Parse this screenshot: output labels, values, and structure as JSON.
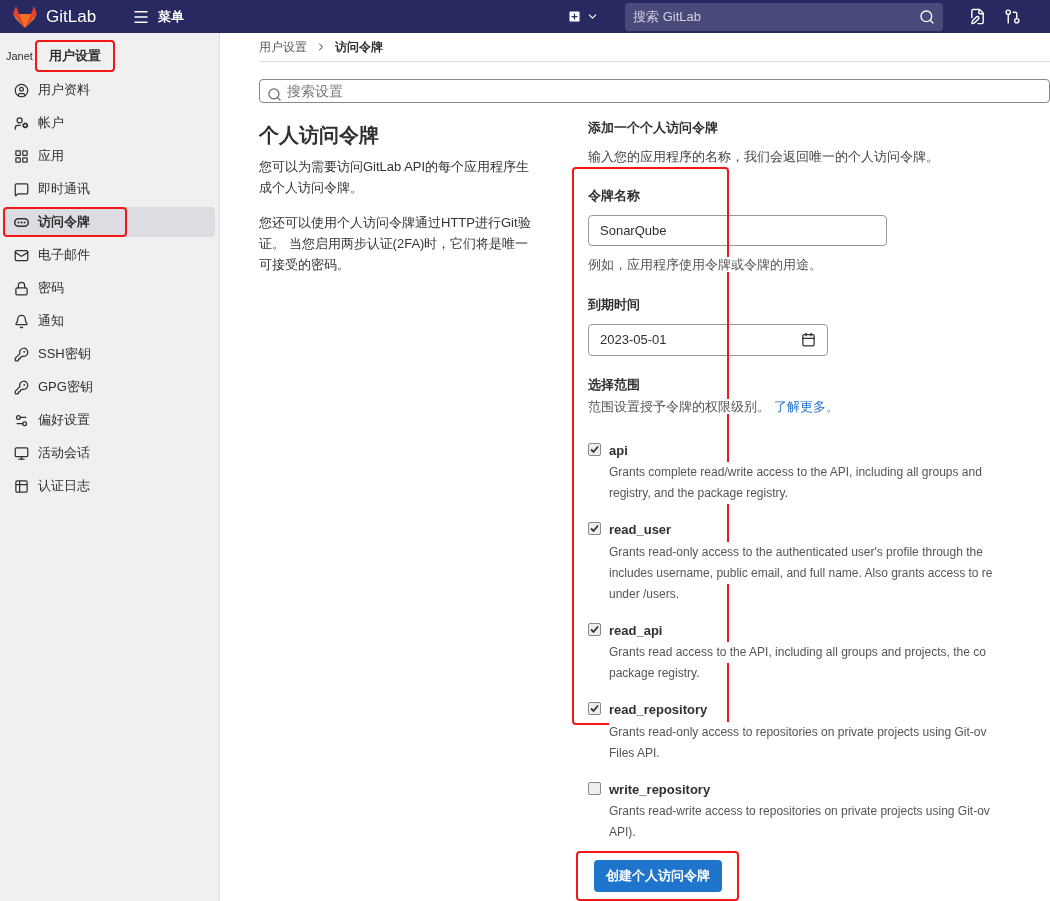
{
  "header": {
    "brand": "GitLab",
    "menu": "菜单",
    "search": {
      "placeholder": "搜索 GitLab"
    }
  },
  "sidebar": {
    "avatar_alt": "Janet",
    "title": "用户设置",
    "highlighted": true,
    "items": [
      {
        "label": "用户资料",
        "selected": false,
        "highlighted": false
      },
      {
        "label": "帐户",
        "selected": false,
        "highlighted": false
      },
      {
        "label": "应用",
        "selected": false,
        "highlighted": false
      },
      {
        "label": "即时通讯",
        "selected": false,
        "highlighted": false
      },
      {
        "label": "访问令牌",
        "selected": true,
        "highlighted": true
      },
      {
        "label": "电子邮件",
        "selected": false,
        "highlighted": false
      },
      {
        "label": "密码",
        "selected": false,
        "highlighted": false
      },
      {
        "label": "通知",
        "selected": false,
        "highlighted": false
      },
      {
        "label": "SSH密钥",
        "selected": false,
        "highlighted": false
      },
      {
        "label": "GPG密钥",
        "selected": false,
        "highlighted": false
      },
      {
        "label": "偏好设置",
        "selected": false,
        "highlighted": false
      },
      {
        "label": "活动会话",
        "selected": false,
        "highlighted": false
      },
      {
        "label": "认证日志",
        "selected": false,
        "highlighted": false
      }
    ]
  },
  "breadcrumb": [
    "用户设置",
    "访问令牌"
  ],
  "settings_search": {
    "placeholder": "搜索设置"
  },
  "intro": {
    "title": "个人访问令牌",
    "paragraphs": [
      "您可以为需要访问GitLab API的每个应用程序生成个人访问令牌。",
      "您还可以使用个人访问令牌通过HTTP进行Git验证。 当您启用两步认证(2FA)时，它们将是唯一可接受的密码。"
    ]
  },
  "form": {
    "heading": "添加一个个人访问令牌",
    "subheading": "输入您的应用程序的名称，我们会返回唯一的个人访问令牌。",
    "highlighted": true,
    "name_label": "令牌名称",
    "name_value": "SonarQube",
    "name_help": "例如，应用程序使用令牌或令牌的用途。",
    "expiry_label": "到期时间",
    "expiry_value": "2023-05-01",
    "scope_label": "选择范围",
    "scope_help": "范围设置授予令牌的权限级别。",
    "scope_link": "了解更多。",
    "scopes": [
      {
        "name": "api",
        "checked": true,
        "lines": [
          "Grants complete read/write access to the API, including all groups and",
          "registry, and the package registry."
        ]
      },
      {
        "name": "read_user",
        "checked": true,
        "lines": [
          "Grants read-only access to the authenticated user's profile through the",
          "includes username, public email, and full name. Also grants access to re",
          "under /users."
        ]
      },
      {
        "name": "read_api",
        "checked": true,
        "lines": [
          "Grants read access to the API, including all groups and projects, the co",
          "package registry."
        ]
      },
      {
        "name": "read_repository",
        "checked": true,
        "lines": [
          "Grants read-only access to repositories on private projects using Git-ov",
          "Files API."
        ]
      },
      {
        "name": "write_repository",
        "checked": false,
        "lines": [
          "Grants read-write access to repositories on private projects using Git-ov",
          "API)."
        ]
      }
    ],
    "submit": {
      "label": "创建个人访问令牌",
      "highlighted": true
    }
  }
}
